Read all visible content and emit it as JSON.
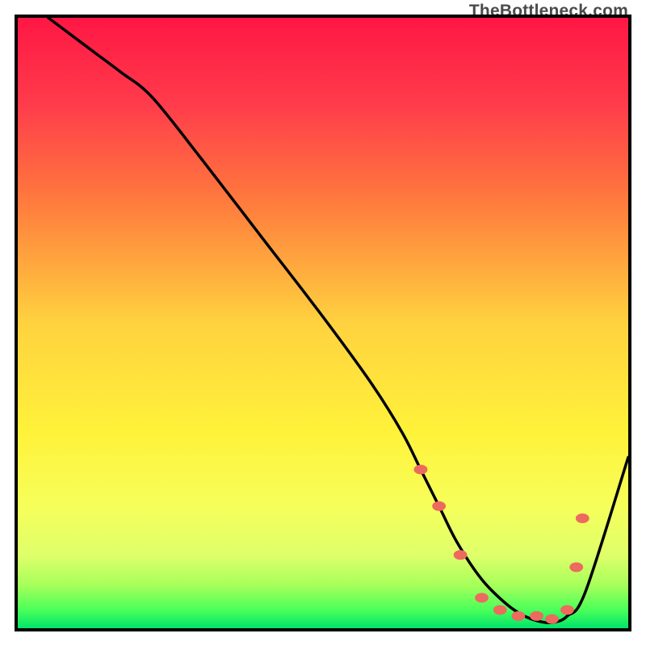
{
  "watermark": "TheBottleneck.com",
  "chart_data": {
    "type": "line",
    "title": "",
    "xlabel": "",
    "ylabel": "",
    "xlim": [
      0,
      100
    ],
    "ylim": [
      0,
      100
    ],
    "gradient_stops": [
      {
        "offset": 0,
        "color": "#ff1744"
      },
      {
        "offset": 14,
        "color": "#ff3b4b"
      },
      {
        "offset": 30,
        "color": "#ff7a3d"
      },
      {
        "offset": 50,
        "color": "#ffd23f"
      },
      {
        "offset": 68,
        "color": "#fff23a"
      },
      {
        "offset": 80,
        "color": "#f6ff5a"
      },
      {
        "offset": 88,
        "color": "#dfff6a"
      },
      {
        "offset": 93,
        "color": "#a6ff5a"
      },
      {
        "offset": 97,
        "color": "#4aff5a"
      },
      {
        "offset": 100,
        "color": "#00e46a"
      }
    ],
    "series": [
      {
        "name": "bottleneck-curve",
        "color": "#000000",
        "x": [
          5,
          9,
          13,
          17,
          22,
          30,
          40,
          50,
          58,
          63,
          66,
          69,
          72,
          76,
          80,
          83,
          86,
          88,
          90,
          93,
          100
        ],
        "y": [
          100,
          97,
          94,
          91,
          87,
          77,
          64,
          51,
          40,
          32,
          26,
          20,
          14,
          8,
          4,
          2,
          1,
          1,
          2,
          6,
          28
        ]
      }
    ],
    "markers": {
      "name": "flat-region-dots",
      "color": "#ed6a5e",
      "radius": 6,
      "points": [
        {
          "x": 66,
          "y": 26
        },
        {
          "x": 69,
          "y": 20
        },
        {
          "x": 72.5,
          "y": 12
        },
        {
          "x": 76,
          "y": 5
        },
        {
          "x": 79,
          "y": 3
        },
        {
          "x": 82,
          "y": 2
        },
        {
          "x": 85,
          "y": 2
        },
        {
          "x": 87.5,
          "y": 1.5
        },
        {
          "x": 90,
          "y": 3
        },
        {
          "x": 91.5,
          "y": 10
        },
        {
          "x": 92.5,
          "y": 18
        }
      ]
    }
  }
}
